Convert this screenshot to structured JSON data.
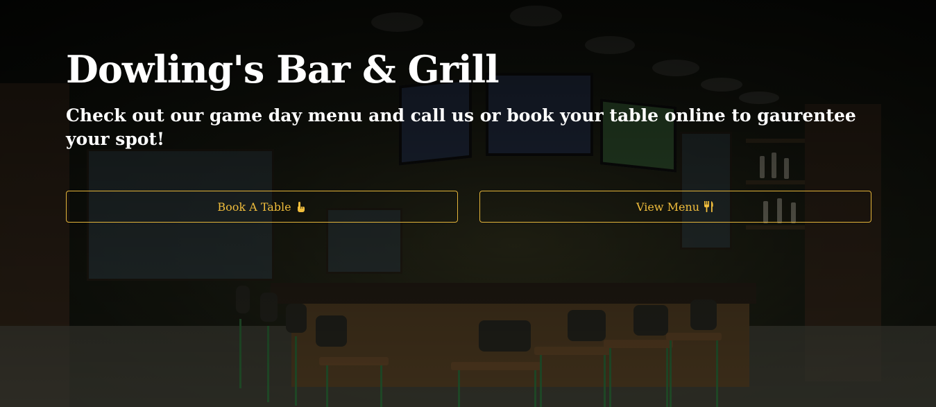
{
  "hero": {
    "title": "Dowling's Bar & Grill",
    "subtitle": "Check out our game day menu and call us or book your table online to gaurentee your spot!"
  },
  "actions": {
    "book_label": "Book A Table",
    "book_icon": "pointing-hand-icon",
    "menu_label": "View Menu",
    "menu_icon": "fork-knife-icon"
  },
  "colors": {
    "accent": "#f0bd3c",
    "title_text": "#ffffff"
  }
}
